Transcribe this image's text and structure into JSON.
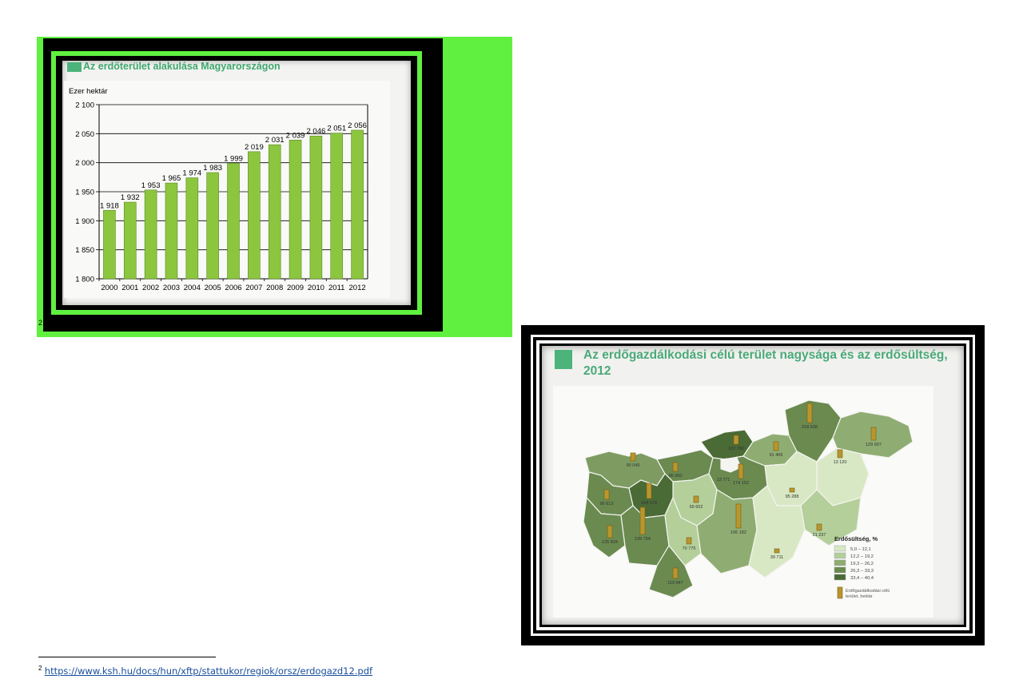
{
  "figure1": {
    "title": "Az erdőterület alakulása Magyarországon",
    "footnote_marker": "2"
  },
  "chart_data": {
    "type": "bar",
    "title": "Az erdőterület alakulása Magyarországon",
    "ylabel": "Ezer hektár",
    "xlabel": "",
    "categories": [
      "2000",
      "2001",
      "2002",
      "2003",
      "2004",
      "2005",
      "2006",
      "2007",
      "2008",
      "2009",
      "2010",
      "2011",
      "2012"
    ],
    "values": [
      1918,
      1932,
      1953,
      1965,
      1974,
      1983,
      1999,
      2019,
      2031,
      2039,
      2046,
      2051,
      2056
    ],
    "value_labels": [
      "1 918",
      "1 932",
      "1 953",
      "1 965",
      "1 974",
      "1 983",
      "1 999",
      "2 019",
      "2 031",
      "2 039",
      "2 046",
      "2 051",
      "2 056"
    ],
    "ylim": [
      1800,
      2100
    ],
    "yticks": [
      1800,
      1850,
      1900,
      1950,
      2000,
      2050,
      2100
    ],
    "ytick_labels": [
      "1 800",
      "1 850",
      "1 900",
      "1 950",
      "2 000",
      "2 050",
      "2 100"
    ],
    "grid": true,
    "colors": {
      "bar": "#8cc63f",
      "bar_edge": "#5a8a22"
    }
  },
  "figure2": {
    "title_line1": "Az erdőgazdálkodási célú terület nagysága és az erdősültség,",
    "title_line2": "2012",
    "legend": {
      "title": "Erdősültség, %",
      "classes": [
        {
          "label": "5,0 – 12,1",
          "color": "#d8e8c4"
        },
        {
          "label": "12,2 – 19,2",
          "color": "#b4cf9a"
        },
        {
          "label": "19,3 – 26,2",
          "color": "#8fad72"
        },
        {
          "label": "26,3 – 33,3",
          "color": "#6a8a50"
        },
        {
          "label": "33,4 – 40,4",
          "color": "#4a6a36"
        }
      ],
      "symbol_label_line1": "Erdőgazdálkodási célú",
      "symbol_label_line2": "terület, hektár"
    },
    "county_values": [
      "218 638",
      "129 607",
      "102 780",
      "91 406",
      "174 152",
      "13 771",
      "13 120",
      "95 288",
      "21 237",
      "39 711",
      "90 049",
      "96 060",
      "69 602",
      "164 179",
      "96 613",
      "125 834",
      "199 794",
      "70 775",
      "106 182",
      "119 947"
    ]
  },
  "footnote": {
    "number": "2",
    "url": "https://www.ksh.hu/docs/hun/xftp/stattukor/regiok/orsz/erdogazd12.pdf"
  }
}
